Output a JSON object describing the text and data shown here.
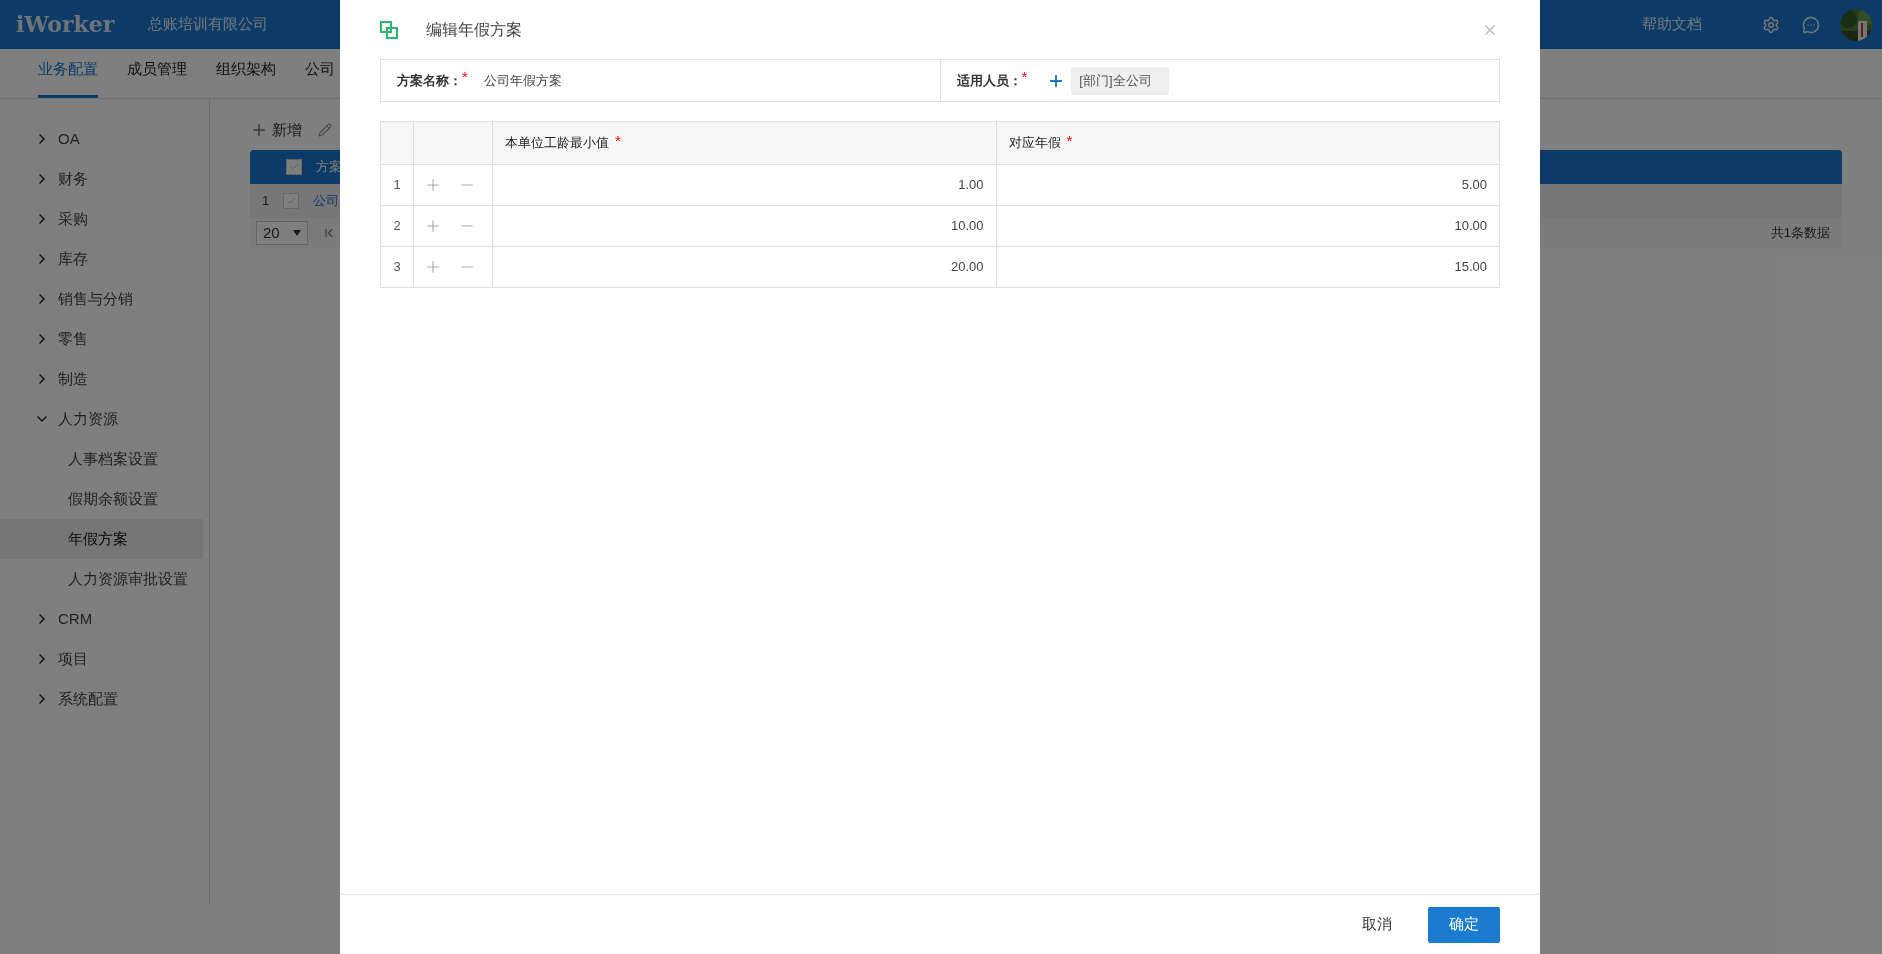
{
  "header": {
    "logo": "iWorker",
    "company": "总账培训有限公司",
    "help": "帮助文档"
  },
  "nav_tabs": [
    {
      "label": "业务配置",
      "selected": true
    },
    {
      "label": "成员管理",
      "selected": false
    },
    {
      "label": "组织架构",
      "selected": false
    },
    {
      "label": "公司",
      "selected": false
    }
  ],
  "sidebar": {
    "items": [
      {
        "label": "OA",
        "expanded": false
      },
      {
        "label": "财务",
        "expanded": false
      },
      {
        "label": "采购",
        "expanded": false
      },
      {
        "label": "库存",
        "expanded": false
      },
      {
        "label": "销售与分销",
        "expanded": false
      },
      {
        "label": "零售",
        "expanded": false
      },
      {
        "label": "制造",
        "expanded": false
      },
      {
        "label": "人力资源",
        "expanded": true,
        "children": [
          {
            "label": "人事档案设置",
            "selected": false
          },
          {
            "label": "假期余额设置",
            "selected": false
          },
          {
            "label": "年假方案",
            "selected": true
          },
          {
            "label": "人力资源审批设置",
            "selected": false
          }
        ]
      },
      {
        "label": "CRM",
        "expanded": false
      },
      {
        "label": "项目",
        "expanded": false
      },
      {
        "label": "系统配置",
        "expanded": false
      }
    ]
  },
  "toolbar": {
    "add": "新增"
  },
  "list_table": {
    "header": "方案",
    "header_checked": false,
    "rows": [
      {
        "index": "1",
        "name": "公司",
        "checked": false
      }
    ],
    "page_size": "20",
    "total": "共1条数据"
  },
  "dialog": {
    "title": "编辑年假方案",
    "fields": [
      {
        "kind": "text",
        "label": "方案名称：",
        "required_mark": "*",
        "value": "公司年假方案"
      },
      {
        "kind": "tags",
        "label": "适用人员：",
        "required_mark": "*",
        "tags": [
          "[部门]全公司"
        ]
      }
    ],
    "table": {
      "columns": [
        {
          "label": "本单位工龄最小值",
          "required_mark": "*"
        },
        {
          "label": "对应年假",
          "required_mark": "*"
        }
      ],
      "rows": [
        {
          "index": "1",
          "values": [
            "1.00",
            "5.00"
          ]
        },
        {
          "index": "2",
          "values": [
            "10.00",
            "10.00"
          ]
        },
        {
          "index": "3",
          "values": [
            "20.00",
            "15.00"
          ]
        }
      ]
    },
    "buttons": {
      "cancel": "取消",
      "ok": "确定"
    }
  }
}
